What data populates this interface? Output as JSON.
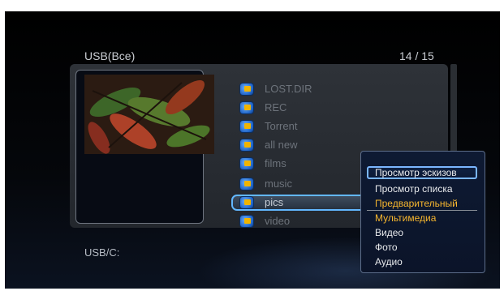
{
  "header": {
    "source_title": "USB(Все)",
    "item_counter": "14 / 15"
  },
  "folders": [
    "LOST.DIR",
    "REC",
    "Torrent",
    "all new",
    "films",
    "music",
    "pics",
    "video"
  ],
  "selected_folder": "pics",
  "footer": {
    "current_path": "USB/C:"
  },
  "context_menu": {
    "items": [
      "Просмотр эскизов",
      "Просмотр списка",
      "Предварительный",
      "Мультимедиа",
      "Видео",
      "Фото",
      "Аудио"
    ],
    "focused_item": "Просмотр эскизов",
    "orange_items": [
      "Предварительный",
      "Мультимедиа"
    ]
  },
  "colors": {
    "highlight_blue": "#62b7ff",
    "menu_orange": "#f6b62e",
    "background": "#000000"
  },
  "icons": {
    "folder": "folder-icon"
  }
}
